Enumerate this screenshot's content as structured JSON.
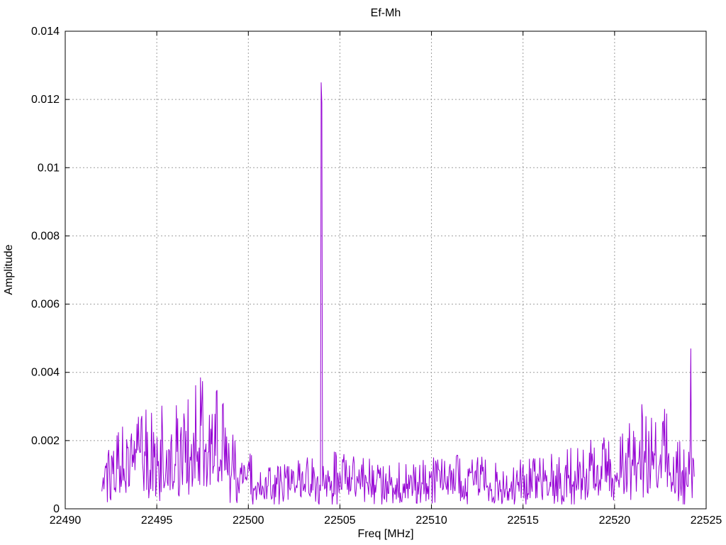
{
  "window": {
    "background": "#ffffff"
  },
  "chart_data": {
    "type": "line",
    "title": "Ef-Mh",
    "xlabel": "Freq [MHz]",
    "ylabel": "Amplitude",
    "xlim": [
      22490,
      22525
    ],
    "ylim": [
      0,
      0.014
    ],
    "xticks": [
      22490,
      22495,
      22500,
      22505,
      22510,
      22515,
      22520,
      22525
    ],
    "xtick_labels": [
      "22490",
      "22495",
      "22500",
      "22505",
      "22510",
      "22515",
      "22520",
      "22525"
    ],
    "yticks": [
      0,
      0.002,
      0.004,
      0.006,
      0.008,
      0.01,
      0.012,
      0.014
    ],
    "ytick_labels": [
      "0",
      "0.002",
      "0.004",
      "0.006",
      "0.008",
      "0.01",
      "0.012",
      "0.014"
    ],
    "grid": true,
    "legend_position": "none",
    "line_color": "#9400d3",
    "grid_color": "#9e9e9e",
    "frame_color": "#000000",
    "text_color": "#000000",
    "data_range": [
      22492.0,
      22524.35
    ],
    "noise_envelope": {
      "x": [
        22492.0,
        22493.0,
        22494.5,
        22495.5,
        22496.6,
        22497.6,
        22498.3,
        22499.0,
        22499.6,
        22500.3,
        22502.0,
        22503.8,
        22504.5,
        22506.0,
        22508.0,
        22510.0,
        22512.0,
        22514.0,
        22516.0,
        22517.5,
        22518.5,
        22519.5,
        22520.3,
        22521.3,
        22522.2,
        22523.0,
        22523.7,
        22524.35
      ],
      "typical": [
        0.0008,
        0.0012,
        0.0013,
        0.0014,
        0.0015,
        0.0017,
        0.0015,
        0.0011,
        0.0009,
        0.0007,
        0.0006,
        0.0007,
        0.0008,
        0.0007,
        0.0006,
        0.0007,
        0.0007,
        0.0006,
        0.0007,
        0.0008,
        0.0009,
        0.001,
        0.0009,
        0.0012,
        0.0014,
        0.0012,
        0.0008,
        0.001
      ],
      "peak": [
        0.0026,
        0.0026,
        0.0031,
        0.003,
        0.0031,
        0.0041,
        0.0037,
        0.0024,
        0.0019,
        0.0015,
        0.0013,
        0.0016,
        0.0017,
        0.0015,
        0.0014,
        0.0015,
        0.0016,
        0.0014,
        0.0015,
        0.0018,
        0.002,
        0.0021,
        0.0021,
        0.0029,
        0.0037,
        0.0031,
        0.0017,
        0.002
      ]
    },
    "spikes": [
      {
        "x": 22503.96,
        "y": 0.0125
      },
      {
        "x": 22504.0,
        "y": 0.0119
      },
      {
        "x": 22524.18,
        "y": 0.0047
      }
    ]
  }
}
